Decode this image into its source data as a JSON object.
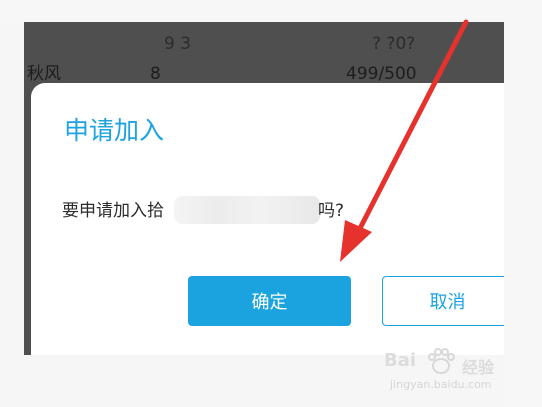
{
  "background_rows": [
    {
      "name": "",
      "level": "9 3",
      "members": "? ?0?"
    },
    {
      "name": "秋风",
      "level": "8",
      "members": "499/500"
    }
  ],
  "dialog": {
    "title": "申请加入",
    "message_prefix": "要申请加入拾",
    "message_suffix": "吗?",
    "confirm_label": "确定",
    "cancel_label": "取消"
  },
  "watermark": {
    "brand": "Bai",
    "brand_suffix": "经验",
    "url": "jingyan.baidu.com"
  },
  "colors": {
    "accent": "#1ba3df",
    "overlay": "#4f4f4f",
    "arrow": "#e5322d"
  }
}
